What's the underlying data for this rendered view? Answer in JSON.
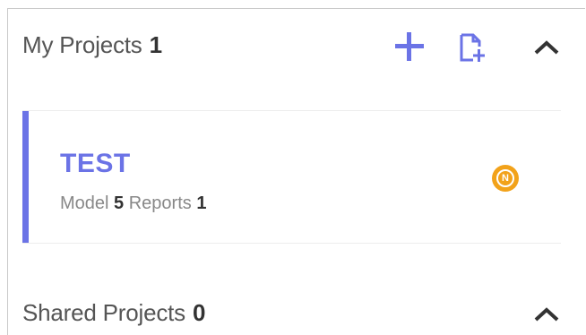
{
  "my_projects": {
    "title": "My Projects",
    "count": "1",
    "actions": {
      "add_icon": "plus-icon",
      "new_file_icon": "new-file-icon",
      "collapse_icon": "chevron-up-icon"
    }
  },
  "projects": [
    {
      "name": "TEST",
      "model_label": "Model",
      "model_count": "5",
      "reports_label": "Reports",
      "reports_count": "1",
      "badge": "N"
    }
  ],
  "shared_projects": {
    "title": "Shared Projects",
    "count": "0",
    "actions": {
      "collapse_icon": "chevron-up-icon"
    }
  },
  "colors": {
    "accent": "#6b73e6",
    "badge": "#f2a21a",
    "text": "#333333",
    "muted": "#888888"
  }
}
